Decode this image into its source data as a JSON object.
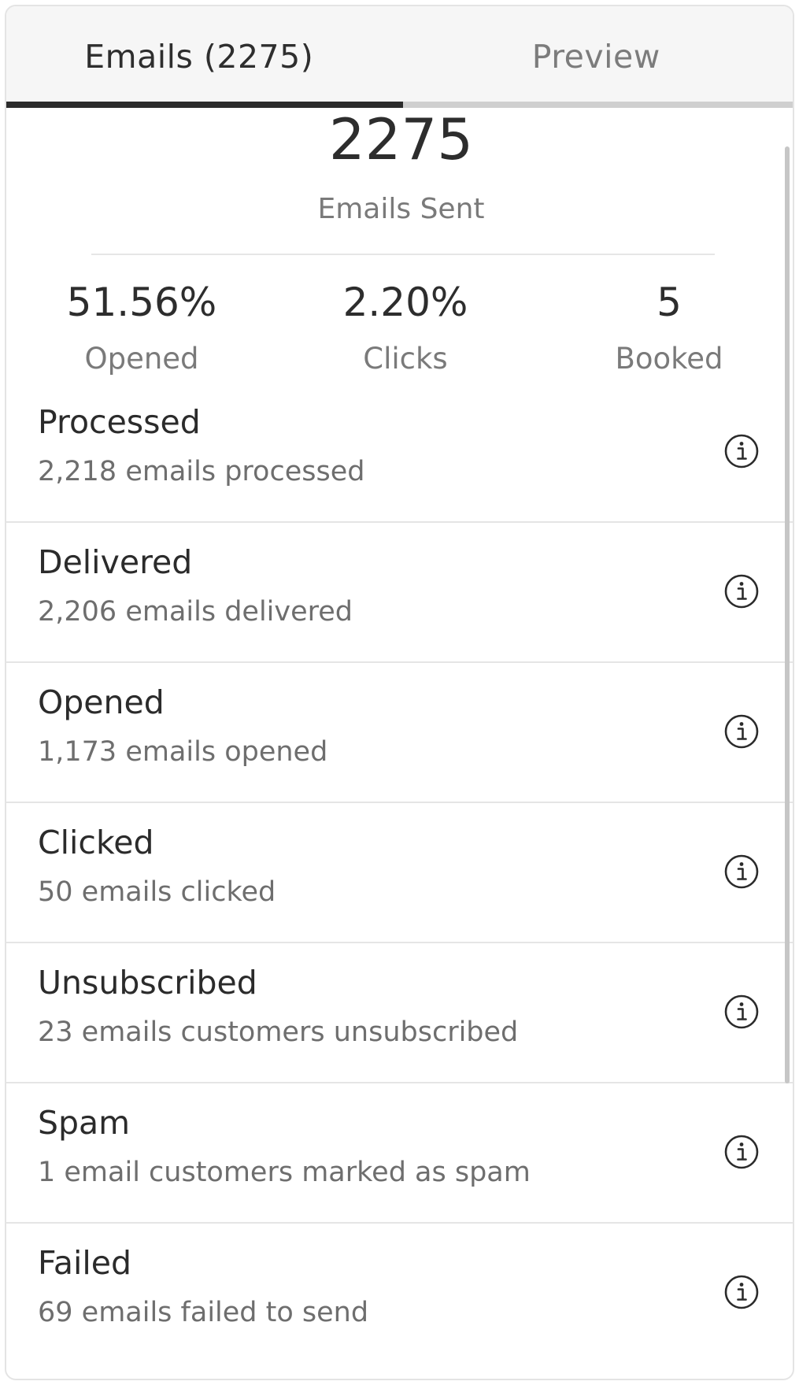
{
  "tabs": [
    {
      "label": "Emails (2275)",
      "active": true
    },
    {
      "label": "Preview",
      "active": false
    }
  ],
  "summary": {
    "total": "2275",
    "total_label": "Emails Sent",
    "stats": [
      {
        "value": "51.56%",
        "label": "Opened"
      },
      {
        "value": "2.20%",
        "label": "Clicks"
      },
      {
        "value": "5",
        "label": "Booked"
      }
    ]
  },
  "rows": [
    {
      "title": "Processed",
      "desc": "2,218 emails processed",
      "icon": "info-icon"
    },
    {
      "title": "Delivered",
      "desc": "2,206 emails delivered",
      "icon": "info-icon"
    },
    {
      "title": "Opened",
      "desc": "1,173 emails opened",
      "icon": "info-icon"
    },
    {
      "title": "Clicked",
      "desc": "50 emails clicked",
      "icon": "info-icon"
    },
    {
      "title": "Unsubscribed",
      "desc": "23 emails customers unsubscribed",
      "icon": "info-icon"
    },
    {
      "title": "Spam",
      "desc": "1 email customers marked as spam",
      "icon": "info-icon"
    },
    {
      "title": "Failed",
      "desc": "69 emails failed to send",
      "icon": "info-icon"
    }
  ],
  "colors": {
    "active_tab_underline": "#2c2c2c",
    "inactive_tab_underline": "#cfcfcf",
    "tab_bar_background": "#f6f6f6"
  }
}
